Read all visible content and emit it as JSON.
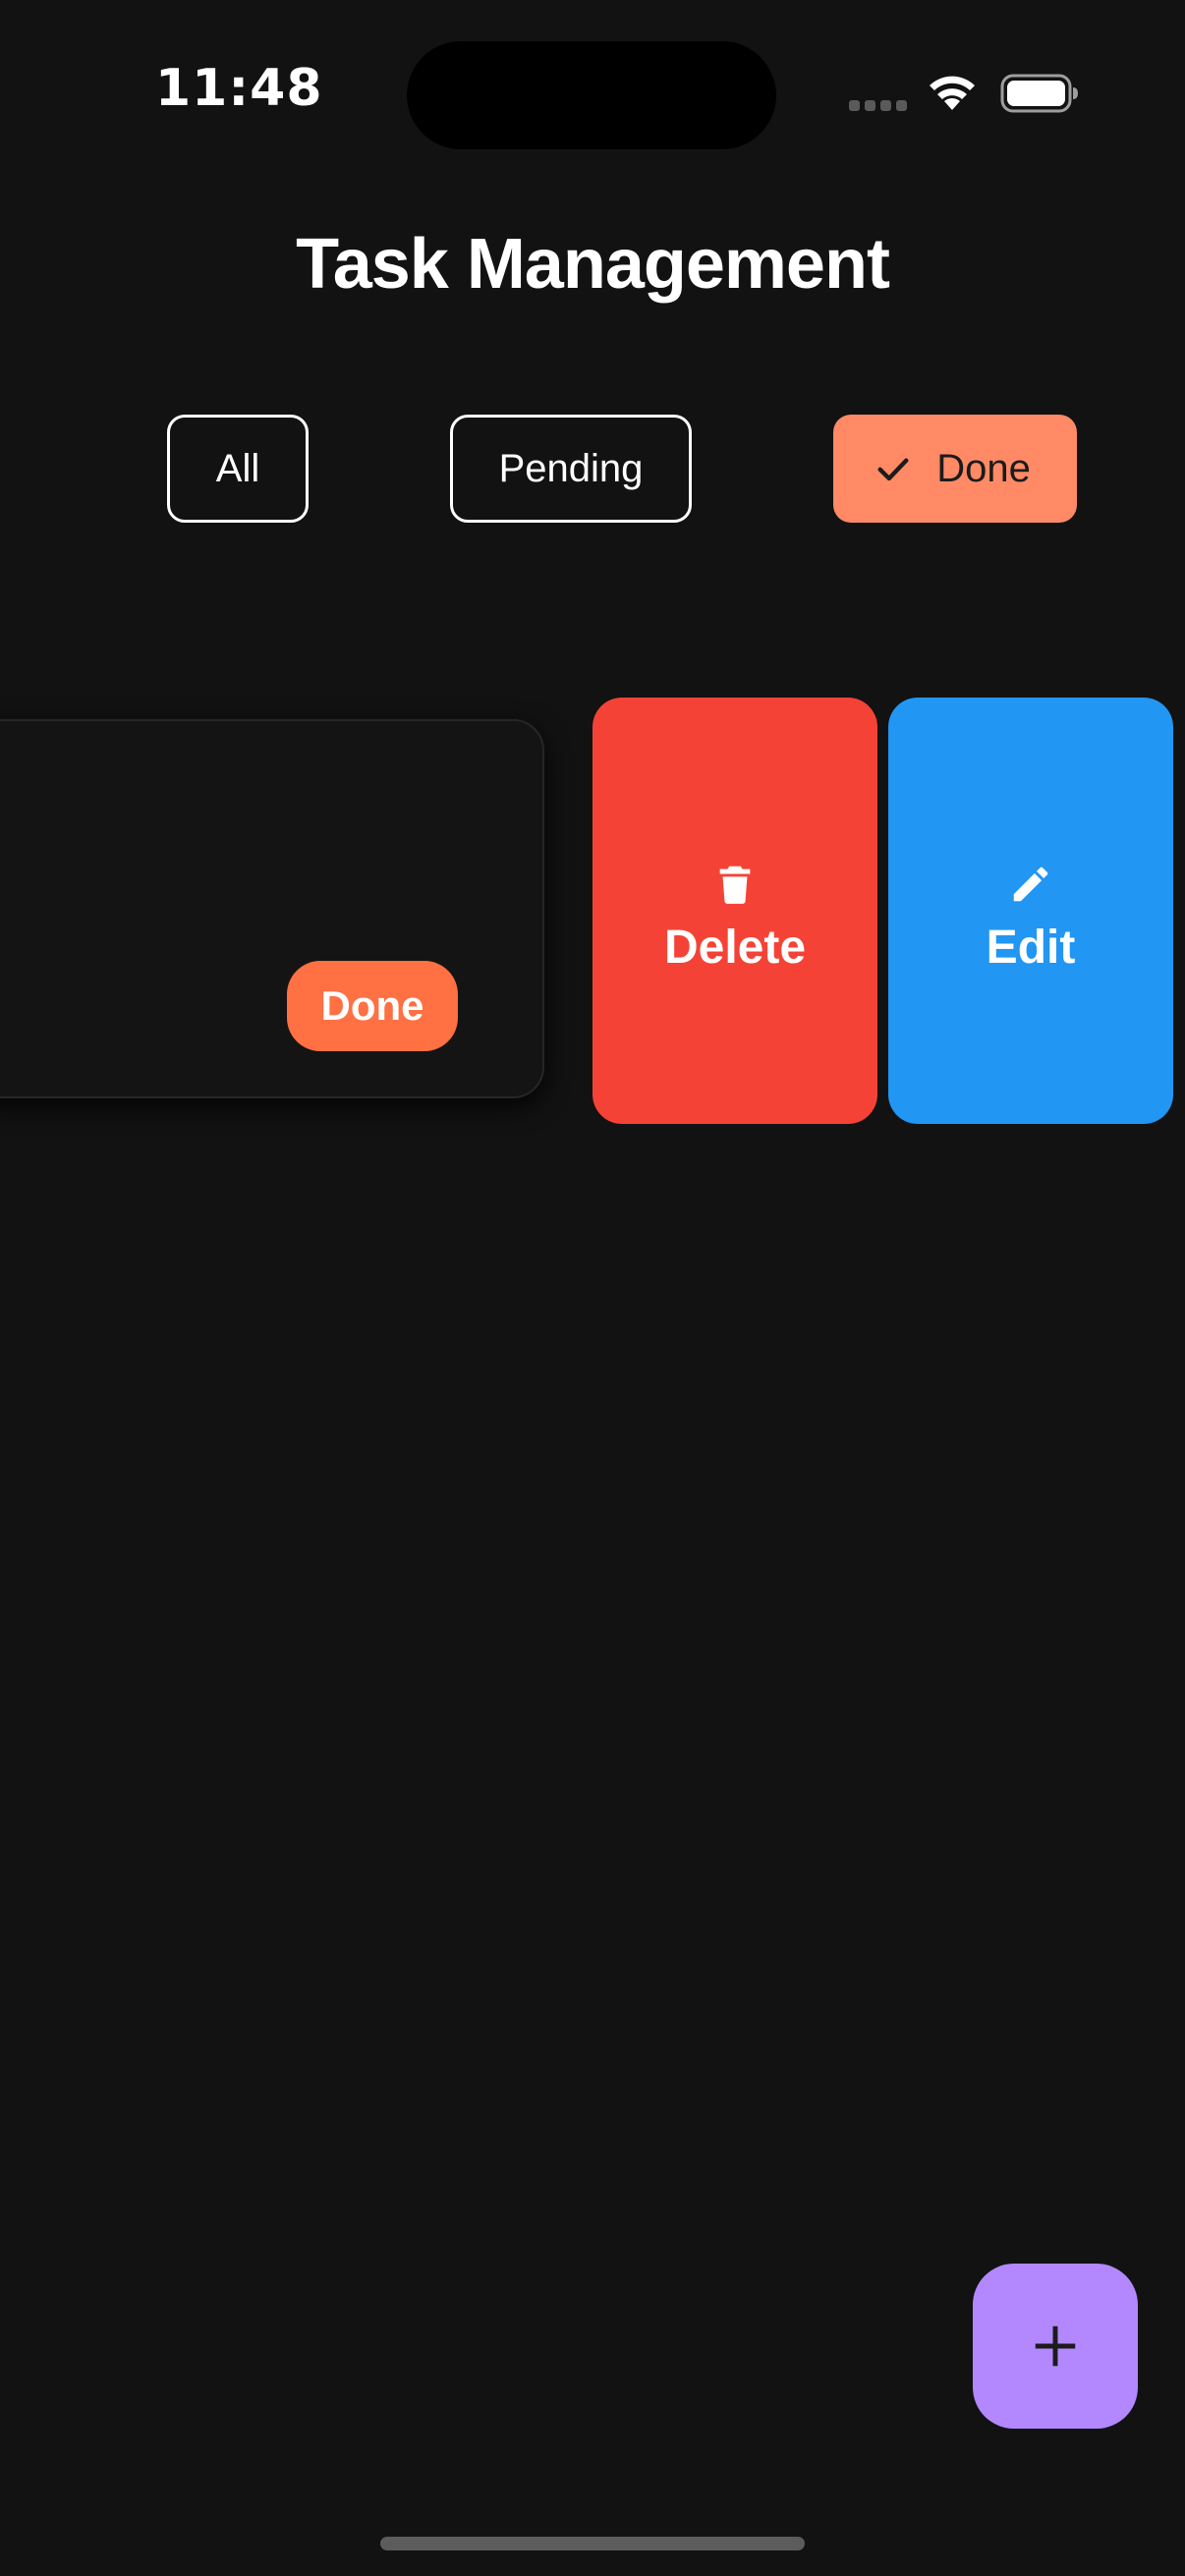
{
  "status_bar": {
    "time": "11:48"
  },
  "header": {
    "title": "Task Management"
  },
  "filters": {
    "all": "All",
    "pending": "Pending",
    "done": "Done",
    "selected": "Done"
  },
  "task_card": {
    "status": "Done"
  },
  "swipe_actions": {
    "delete": "Delete",
    "edit": "Edit"
  },
  "icons": {
    "filter_selected": "check-icon",
    "delete": "trash-icon",
    "edit": "pencil-icon",
    "fab": "plus-icon"
  },
  "colors": {
    "background": "#121212",
    "done_chip": "#ff8a65",
    "status_pill": "#ff7043",
    "delete": "#f44336",
    "edit": "#2196f3",
    "fab": "#b388ff"
  }
}
